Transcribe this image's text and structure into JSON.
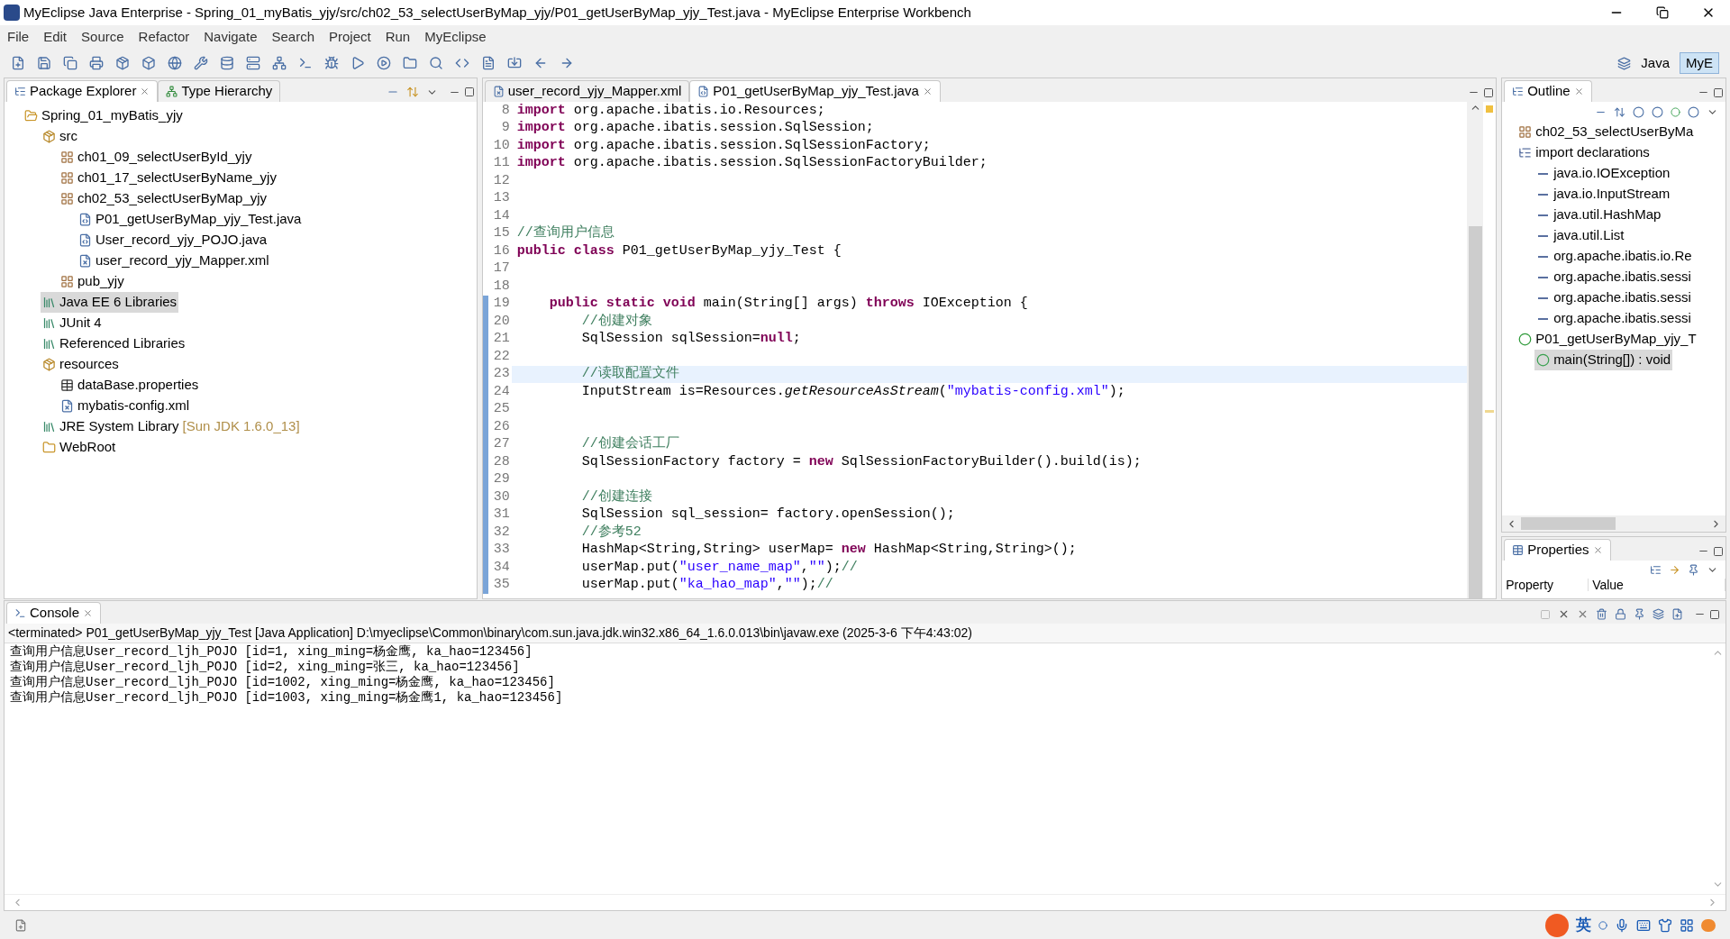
{
  "window": {
    "title": "MyEclipse Java Enterprise - Spring_01_myBatis_yjy/src/ch02_53_selectUserByMap_yjy/P01_getUserByMap_yjy_Test.java - MyEclipse Enterprise Workbench"
  },
  "menu": [
    "File",
    "Edit",
    "Source",
    "Refactor",
    "Navigate",
    "Search",
    "Project",
    "Run",
    "MyEclipse"
  ],
  "perspectives": [
    {
      "label": "Java",
      "selected": false
    },
    {
      "label": "MyE",
      "selected": true
    }
  ],
  "explorer": {
    "tabs": [
      {
        "label": "Package Explorer",
        "selected": true
      },
      {
        "label": "Type Hierarchy",
        "selected": false
      }
    ],
    "tree": [
      {
        "label": "Spring_01_myBatis_yjy",
        "kind": "project",
        "selected": false,
        "children": [
          {
            "label": "src",
            "kind": "source-folder",
            "selected": false,
            "children": [
              {
                "label": "ch01_09_selectUserById_yjy",
                "kind": "package",
                "selected": false
              },
              {
                "label": "ch01_17_selectUserByName_yjy",
                "kind": "package",
                "selected": false
              },
              {
                "label": "ch02_53_selectUserByMap_yjy",
                "kind": "package",
                "selected": false,
                "children": [
                  {
                    "label": "P01_getUserByMap_yjy_Test.java",
                    "kind": "java-file",
                    "selected": false
                  },
                  {
                    "label": "User_record_yjy_POJO.java",
                    "kind": "java-file",
                    "selected": false
                  },
                  {
                    "label": "user_record_yjy_Mapper.xml",
                    "kind": "xml-file",
                    "selected": false
                  }
                ]
              },
              {
                "label": "pub_yjy",
                "kind": "package",
                "selected": false
              }
            ]
          },
          {
            "label": "Java EE 6 Libraries",
            "kind": "library",
            "selected": true
          },
          {
            "label": "JUnit 4",
            "kind": "library",
            "selected": false
          },
          {
            "label": "Referenced Libraries",
            "kind": "library",
            "selected": false
          },
          {
            "label": "resources",
            "kind": "source-folder",
            "selected": false,
            "children": [
              {
                "label": "dataBase.properties",
                "kind": "properties-file",
                "selected": false
              },
              {
                "label": "mybatis-config.xml",
                "kind": "xml-file",
                "selected": false
              }
            ]
          },
          {
            "label": "JRE System Library",
            "decoration": "[Sun JDK 1.6.0_13]",
            "kind": "library",
            "selected": false
          },
          {
            "label": "WebRoot",
            "kind": "folder",
            "selected": false
          }
        ]
      }
    ]
  },
  "editor": {
    "tabs": [
      {
        "label": "user_record_yjy_Mapper.xml",
        "kind": "xml-file",
        "selected": false
      },
      {
        "label": "P01_getUserByMap_yjy_Test.java",
        "kind": "java-file",
        "selected": true
      }
    ],
    "lines": [
      {
        "no": "8",
        "changed": false,
        "current": false,
        "segments": [
          {
            "kind": "kw",
            "text": "import"
          },
          {
            "kind": "plain",
            "text": " org.apache.ibatis.io.Resources;"
          }
        ]
      },
      {
        "no": "9",
        "changed": false,
        "current": false,
        "segments": [
          {
            "kind": "kw",
            "text": "import"
          },
          {
            "kind": "plain",
            "text": " org.apache.ibatis.session.SqlSession;"
          }
        ]
      },
      {
        "no": "10",
        "changed": false,
        "current": false,
        "segments": [
          {
            "kind": "kw",
            "text": "import"
          },
          {
            "kind": "plain",
            "text": " org.apache.ibatis.session.SqlSessionFactory;"
          }
        ]
      },
      {
        "no": "11",
        "changed": false,
        "current": false,
        "segments": [
          {
            "kind": "kw",
            "text": "import"
          },
          {
            "kind": "plain",
            "text": " org.apache.ibatis.session.SqlSessionFactoryBuilder;"
          }
        ]
      },
      {
        "no": "12",
        "changed": false,
        "current": false
      },
      {
        "no": "13",
        "changed": false,
        "current": false
      },
      {
        "no": "14",
        "changed": false,
        "current": false
      },
      {
        "no": "15",
        "changed": false,
        "current": false,
        "segments": [
          {
            "kind": "comment",
            "text": "//查询用户信息"
          }
        ]
      },
      {
        "no": "16",
        "changed": false,
        "current": false,
        "segments": [
          {
            "kind": "kw",
            "text": "public class"
          },
          {
            "kind": "plain",
            "text": " P01_getUserByMap_yjy_Test {"
          }
        ]
      },
      {
        "no": "17",
        "changed": false,
        "current": false
      },
      {
        "no": "18",
        "changed": false,
        "current": false
      },
      {
        "no": "19",
        "changed": true,
        "current": false,
        "segments": [
          {
            "kind": "kw",
            "text": "    public static void"
          },
          {
            "kind": "plain",
            "text": " main(String[] args) "
          },
          {
            "kind": "kw",
            "text": "throws"
          },
          {
            "kind": "plain",
            "text": " IOException {"
          }
        ]
      },
      {
        "no": "20",
        "changed": true,
        "current": false,
        "segments": [
          {
            "kind": "comment",
            "text": "        //创建对象"
          }
        ]
      },
      {
        "no": "21",
        "changed": true,
        "current": false,
        "segments": [
          {
            "kind": "plain",
            "text": "        SqlSession sqlSession="
          },
          {
            "kind": "kw",
            "text": "null"
          },
          {
            "kind": "plain",
            "text": ";"
          }
        ]
      },
      {
        "no": "22",
        "changed": true,
        "current": false
      },
      {
        "no": "23",
        "changed": true,
        "current": true,
        "segments": [
          {
            "kind": "comment",
            "text": "        //读取配置文件"
          }
        ]
      },
      {
        "no": "24",
        "changed": true,
        "current": false,
        "segments": [
          {
            "kind": "plain",
            "text": "        InputStream is=Resources."
          },
          {
            "kind": "italic",
            "text": "getResourceAsStream"
          },
          {
            "kind": "plain",
            "text": "("
          },
          {
            "kind": "string",
            "text": "\"mybatis-config.xml\""
          },
          {
            "kind": "plain",
            "text": ");"
          }
        ]
      },
      {
        "no": "25",
        "changed": true,
        "current": false
      },
      {
        "no": "26",
        "changed": true,
        "current": false
      },
      {
        "no": "27",
        "changed": true,
        "current": false,
        "segments": [
          {
            "kind": "comment",
            "text": "        //创建会话工厂"
          }
        ]
      },
      {
        "no": "28",
        "changed": true,
        "current": false,
        "segments": [
          {
            "kind": "plain",
            "text": "        SqlSessionFactory factory = "
          },
          {
            "kind": "kw",
            "text": "new"
          },
          {
            "kind": "plain",
            "text": " SqlSessionFactoryBuilder().build(is);"
          }
        ]
      },
      {
        "no": "29",
        "changed": true,
        "current": false
      },
      {
        "no": "30",
        "changed": true,
        "current": false,
        "segments": [
          {
            "kind": "comment",
            "text": "        //创建连接"
          }
        ]
      },
      {
        "no": "31",
        "changed": true,
        "current": false,
        "segments": [
          {
            "kind": "plain",
            "text": "        SqlSession sql_session= factory.openSession();"
          }
        ]
      },
      {
        "no": "32",
        "changed": true,
        "current": false,
        "segments": [
          {
            "kind": "comment",
            "text": "        //参考52"
          }
        ]
      },
      {
        "no": "33",
        "changed": true,
        "current": false,
        "segments": [
          {
            "kind": "plain",
            "text": "        HashMap<String,String> userMap= "
          },
          {
            "kind": "kw",
            "text": "new"
          },
          {
            "kind": "plain",
            "text": " HashMap<String,String>();"
          }
        ]
      },
      {
        "no": "34",
        "changed": true,
        "current": false,
        "segments": [
          {
            "kind": "plain",
            "text": "        userMap.put("
          },
          {
            "kind": "string",
            "text": "\"user_name_map\""
          },
          {
            "kind": "plain",
            "text": ","
          },
          {
            "kind": "string",
            "text": "\"\""
          },
          {
            "kind": "plain",
            "text": ");"
          },
          {
            "kind": "comment",
            "text": "//"
          }
        ]
      },
      {
        "no": "35",
        "changed": true,
        "current": false,
        "segments": [
          {
            "kind": "plain",
            "text": "        userMap.put("
          },
          {
            "kind": "string",
            "text": "\"ka_hao_map\""
          },
          {
            "kind": "plain",
            "text": ","
          },
          {
            "kind": "string",
            "text": "\"\""
          },
          {
            "kind": "plain",
            "text": ");"
          },
          {
            "kind": "comment",
            "text": "//"
          }
        ]
      }
    ]
  },
  "outline": {
    "title": "Outline",
    "tree": [
      {
        "label": "ch02_53_selectUserByMa",
        "kind": "package",
        "selected": false
      },
      {
        "label": "import declarations",
        "kind": "imports",
        "selected": false,
        "children": [
          {
            "label": "java.io.IOException",
            "kind": "import",
            "selected": false
          },
          {
            "label": "java.io.InputStream",
            "kind": "import",
            "selected": false
          },
          {
            "label": "java.util.HashMap",
            "kind": "import",
            "selected": false
          },
          {
            "label": "java.util.List",
            "kind": "import",
            "selected": false
          },
          {
            "label": "org.apache.ibatis.io.Re",
            "kind": "import",
            "selected": false
          },
          {
            "label": "org.apache.ibatis.sessi",
            "kind": "import",
            "selected": false
          },
          {
            "label": "org.apache.ibatis.sessi",
            "kind": "import",
            "selected": false
          },
          {
            "label": "org.apache.ibatis.sessi",
            "kind": "import",
            "selected": false
          }
        ]
      },
      {
        "label": "P01_getUserByMap_yjy_T",
        "kind": "class",
        "selected": false,
        "children": [
          {
            "label": "main(String[]) : void",
            "kind": "method",
            "selected": true
          }
        ]
      }
    ]
  },
  "properties": {
    "title": "Properties",
    "columns": [
      "Property",
      "Value"
    ]
  },
  "console": {
    "title": "Console",
    "status": "<terminated> P01_getUserByMap_yjy_Test [Java Application] D:\\myeclipse\\Common\\binary\\com.sun.java.jdk.win32.x86_64_1.6.0.013\\bin\\javaw.exe (2025-3-6 下午4:43:02)",
    "lines": [
      "查询用户信息User_record_ljh_POJO [id=1, xing_ming=杨金鹰, ka_hao=123456]",
      "查询用户信息User_record_ljh_POJO [id=2, xing_ming=张三, ka_hao=123456]",
      "查询用户信息User_record_ljh_POJO [id=1002, xing_ming=杨金鹰, ka_hao=123456]",
      "查询用户信息User_record_ljh_POJO [id=1003, xing_ming=杨金鹰1, ka_hao=123456]"
    ]
  },
  "tray": {
    "ime_mode": "英"
  }
}
